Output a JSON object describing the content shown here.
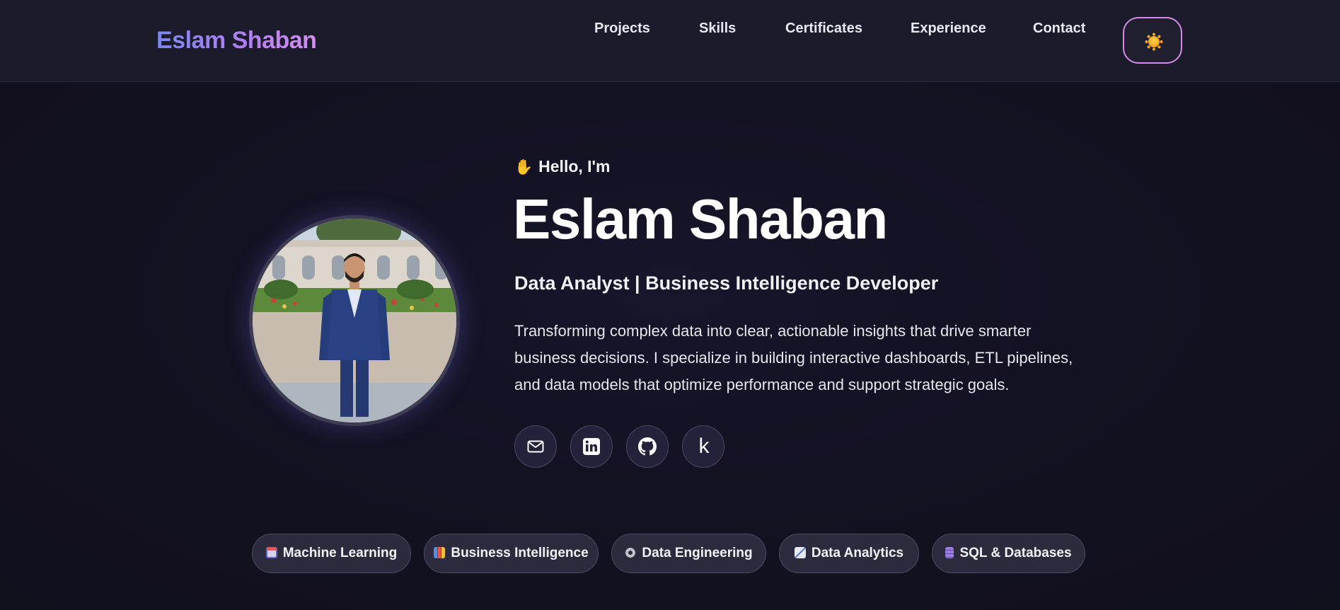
{
  "header": {
    "brand": "Eslam Shaban",
    "nav": [
      {
        "label": "Projects"
      },
      {
        "label": "Skills"
      },
      {
        "label": "Certificates"
      },
      {
        "label": "Experience"
      },
      {
        "label": "Contact"
      }
    ],
    "theme_toggle_icon": "sun-icon"
  },
  "hero": {
    "greeting_icon": "waving-hand-icon",
    "greeting": "Hello, I'm",
    "name": "Eslam Shaban",
    "role": "Data Analyst | Business Intelligence Developer",
    "description": "Transforming complex data into clear, actionable insights that drive smarter business decisions. I specialize in building interactive dashboards, ETL pipelines, and data models that optimize performance and support strategic goals.",
    "socials": [
      {
        "icon": "email-icon"
      },
      {
        "icon": "linkedin-icon"
      },
      {
        "icon": "github-icon"
      },
      {
        "icon": "kaggle-icon",
        "glyph": "k"
      }
    ]
  },
  "skills": [
    {
      "icon": "robot-icon",
      "label": "Machine Learning"
    },
    {
      "icon": "bar-chart-icon",
      "label": "Business Intelligence"
    },
    {
      "icon": "gear-icon",
      "label": "Data Engineering"
    },
    {
      "icon": "trend-chart-icon",
      "label": "Data Analytics"
    },
    {
      "icon": "database-icon",
      "label": "SQL & Databases"
    }
  ],
  "colors": {
    "background": "#12111f",
    "header": "#1b1b2c",
    "brand_gradient_start": "#7b87ee",
    "brand_gradient_end": "#d58ef0",
    "toggle_border": "#d68ce6",
    "sun": "#f5a623"
  }
}
